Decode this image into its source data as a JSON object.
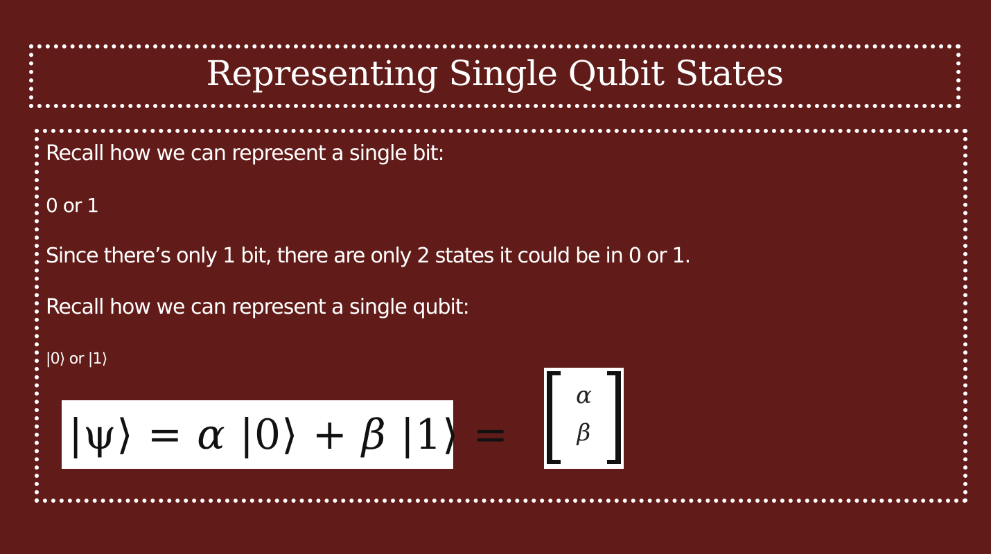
{
  "slide": {
    "title": "Representing Single Qubit States",
    "lines": [
      "Recall how we can represent a single bit:",
      "0 or 1",
      "Since there’s only 1 bit, there are only 2 states it could be in 0 or 1.",
      "Recall how we can represent a single qubit:",
      "|0⟩ or |1⟩"
    ],
    "equation": {
      "psi": "|ψ⟩",
      "equals": " = ",
      "alpha": "α",
      "ket0": " |0⟩ + ",
      "beta": "β",
      "ket1": " |1⟩ ="
    },
    "vector": {
      "top": "α",
      "bottom": "β"
    }
  }
}
